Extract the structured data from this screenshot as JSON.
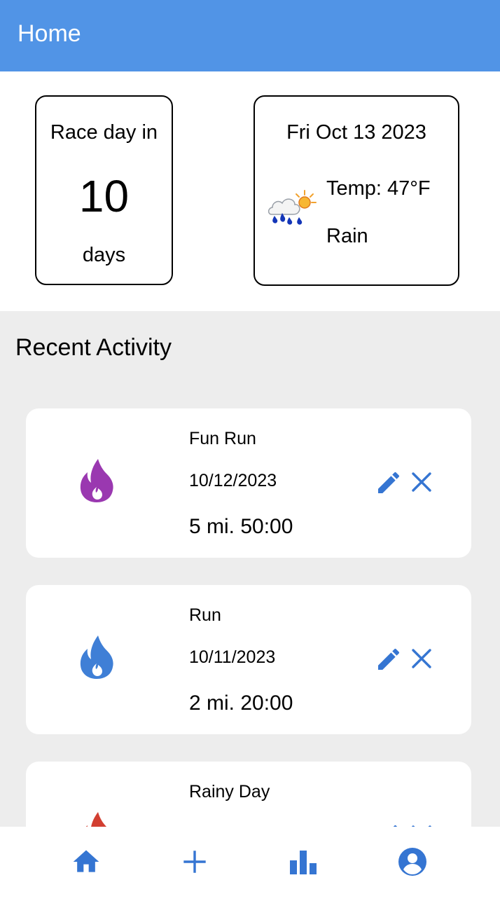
{
  "header": {
    "title": "Home"
  },
  "race_countdown": {
    "prefix": "Race day in",
    "count": "10",
    "suffix": "days"
  },
  "weather": {
    "date": "Fri Oct 13 2023",
    "temp": "Temp: 47°F",
    "condition": "Rain",
    "icon": "rain-cloud-sun-icon"
  },
  "recent_activity": {
    "title": "Recent Activity",
    "items": [
      {
        "name": "Fun Run",
        "date": "10/12/2023",
        "stats": "5 mi. 50:00",
        "flame_color": "#9A38B0"
      },
      {
        "name": "Run",
        "date": "10/11/2023",
        "stats": "2 mi. 20:00",
        "flame_color": "#3F7FD6"
      },
      {
        "name": "Rainy Day",
        "date": "",
        "stats": "",
        "flame_color": "#D23F31"
      }
    ]
  },
  "colors": {
    "primary": "#5194E6",
    "icon_blue": "#3575D2",
    "section_bg": "#EDEDED"
  },
  "bottom_nav": {
    "items": [
      {
        "id": "home",
        "icon": "home-icon"
      },
      {
        "id": "add",
        "icon": "plus-icon"
      },
      {
        "id": "stats",
        "icon": "bar-chart-icon"
      },
      {
        "id": "profile",
        "icon": "account-circle-icon"
      }
    ]
  }
}
